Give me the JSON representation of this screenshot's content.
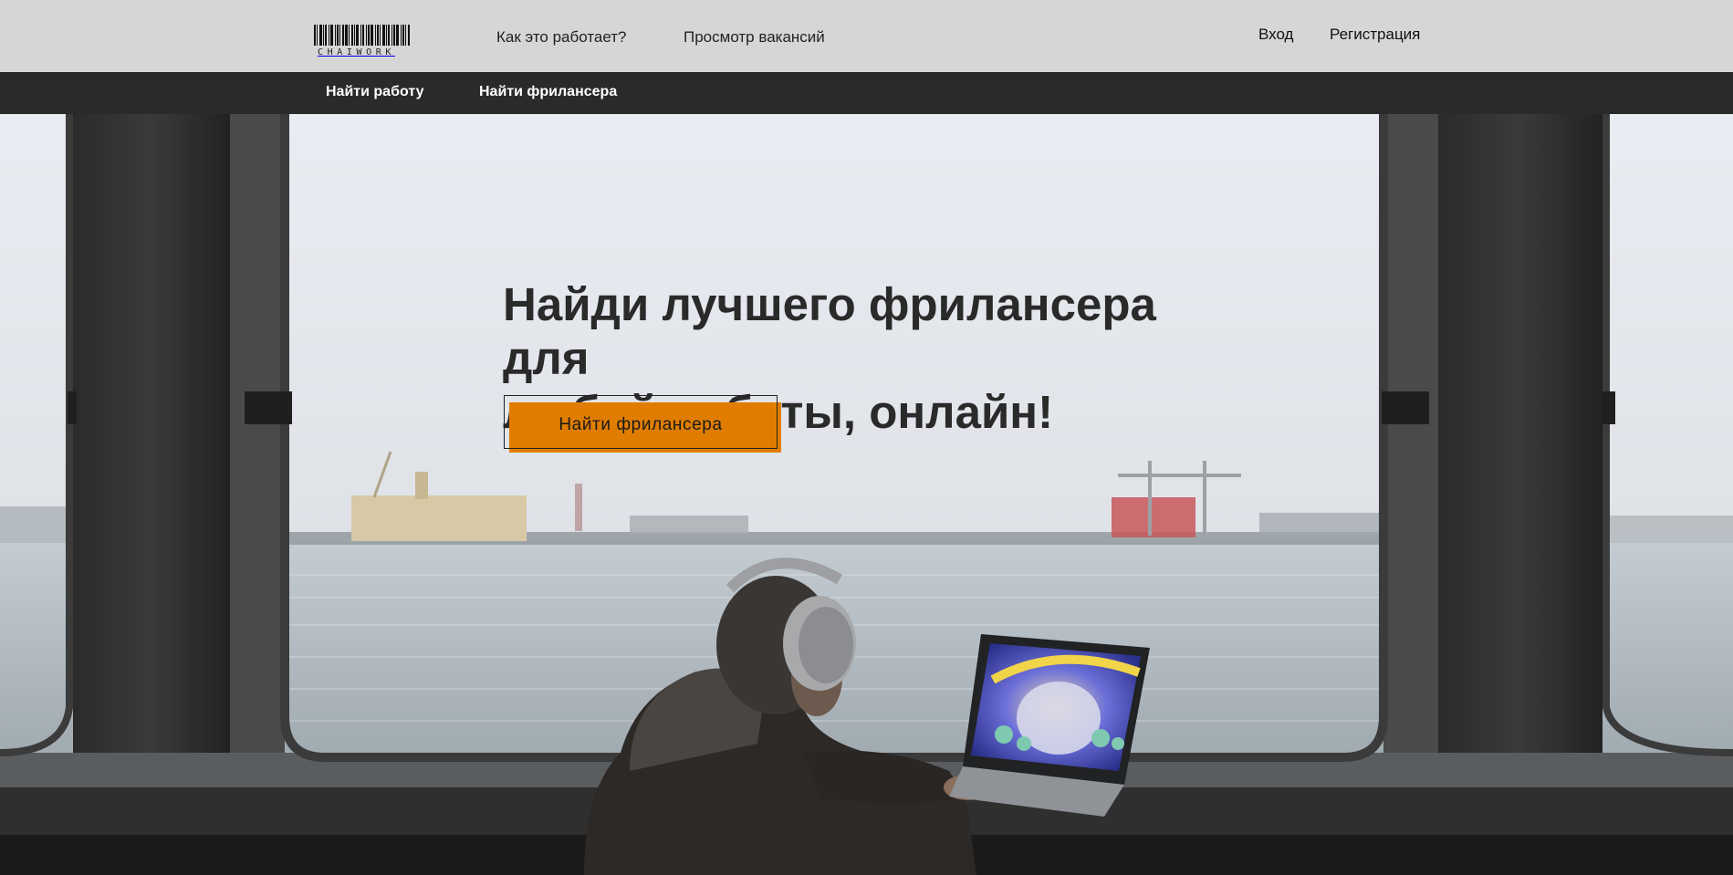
{
  "header": {
    "logo_text": "CHAIWORK",
    "nav": {
      "how_it_works": "Как это работает?",
      "browse_jobs": "Просмотр вакансий"
    },
    "auth": {
      "login": "Вход",
      "register": "Регистрация"
    }
  },
  "subnav": {
    "find_work": "Найти работу",
    "find_freelancer": "Найти фрилансера"
  },
  "hero": {
    "title_line1": "Найди лучшего фрилансера для",
    "title_line2": "любой работы, онлайн!",
    "cta_label": "Найти фрилансера",
    "accent_color": "#e07d00"
  }
}
